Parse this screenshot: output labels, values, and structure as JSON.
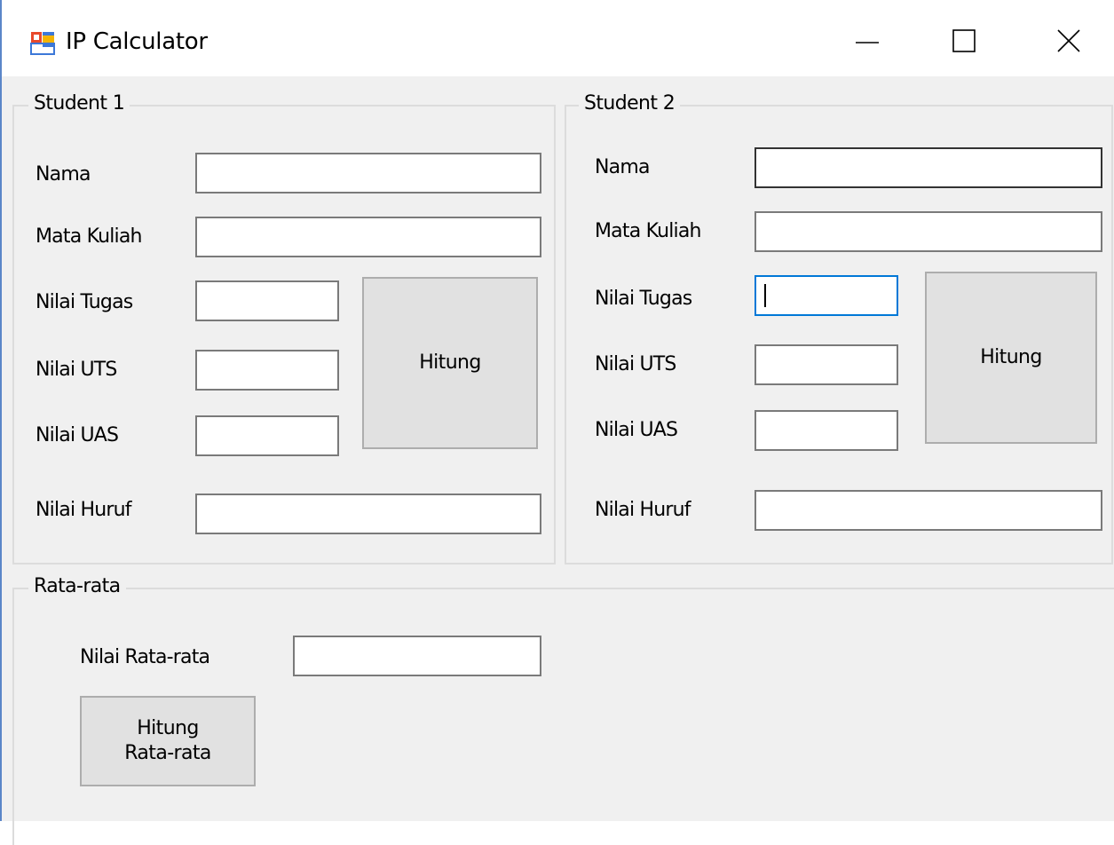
{
  "window": {
    "title": "IP Calculator",
    "controls": [
      "minimize",
      "maximize",
      "close"
    ]
  },
  "student1": {
    "group_title": "Student 1",
    "labels": {
      "nama": "Nama",
      "mata_kuliah": "Mata Kuliah",
      "nilai_tugas": "Nilai Tugas",
      "nilai_uts": "Nilai UTS",
      "nilai_uas": "Nilai UAS",
      "nilai_huruf": "Nilai Huruf"
    },
    "values": {
      "nama": "",
      "mata_kuliah": "",
      "nilai_tugas": "",
      "nilai_uts": "",
      "nilai_uas": "",
      "nilai_huruf": ""
    },
    "button_label": "Hitung"
  },
  "student2": {
    "group_title": "Student 2",
    "labels": {
      "nama": "Nama",
      "mata_kuliah": "Mata Kuliah",
      "nilai_tugas": "Nilai Tugas",
      "nilai_uts": "Nilai UTS",
      "nilai_uas": "Nilai UAS",
      "nilai_huruf": "Nilai Huruf"
    },
    "values": {
      "nama": "",
      "mata_kuliah": "",
      "nilai_tugas": "",
      "nilai_uts": "",
      "nilai_uas": "",
      "nilai_huruf": ""
    },
    "button_label": "Hitung"
  },
  "average": {
    "group_title": "Rata-rata",
    "label": "Nilai Rata-rata",
    "value": "",
    "button_line1": "Hitung",
    "button_line2": "Rata-rata"
  },
  "icons": {
    "app": "app-window-icon",
    "minimize": "minimize-icon",
    "maximize": "maximize-icon",
    "close": "close-icon"
  },
  "colors": {
    "window_bg": "#f0f0f0",
    "titlebar_bg": "#ffffff",
    "button_bg": "#e1e1e1",
    "focus_border": "#0078d7",
    "window_edge": "#5a86c8"
  }
}
